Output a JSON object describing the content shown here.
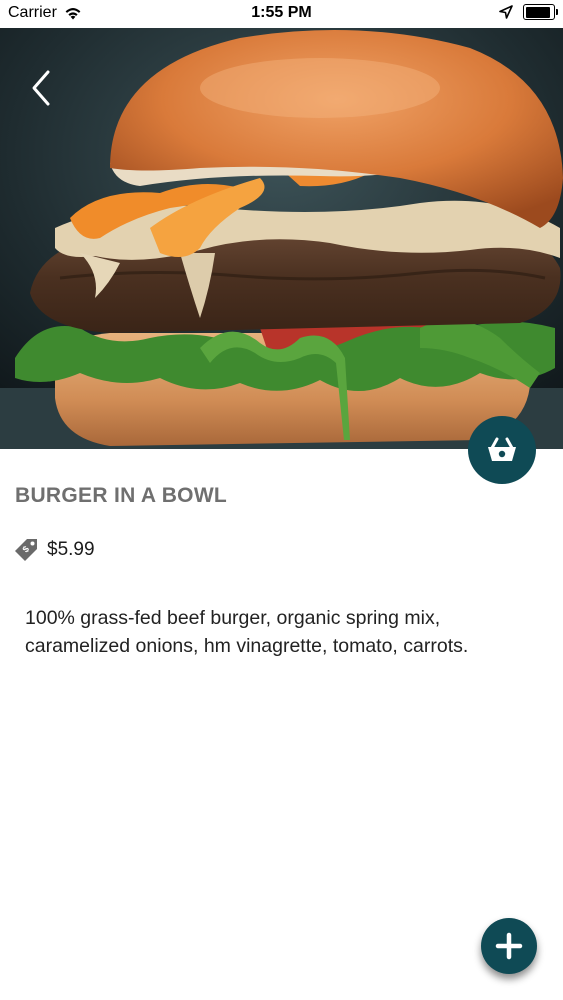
{
  "status_bar": {
    "carrier": "Carrier",
    "time": "1:55 PM",
    "battery_level": 0.9
  },
  "hero": {
    "image": "burger-photo"
  },
  "product": {
    "title": "BURGER IN A BOWL",
    "price": "$5.99",
    "description": "100% grass-fed beef burger, organic spring mix, caramelized onions, hm vinagrette, tomato, carrots."
  },
  "icons": {
    "back": "chevron-left-icon",
    "cart": "basket-icon",
    "price_tag": "price-tag-icon",
    "add": "plus-icon",
    "wifi": "wifi-icon",
    "location": "location-arrow-icon",
    "battery": "battery-icon"
  },
  "colors": {
    "accent": "#0f4a55",
    "title_gray": "#6f6f6f",
    "text": "#222222"
  }
}
